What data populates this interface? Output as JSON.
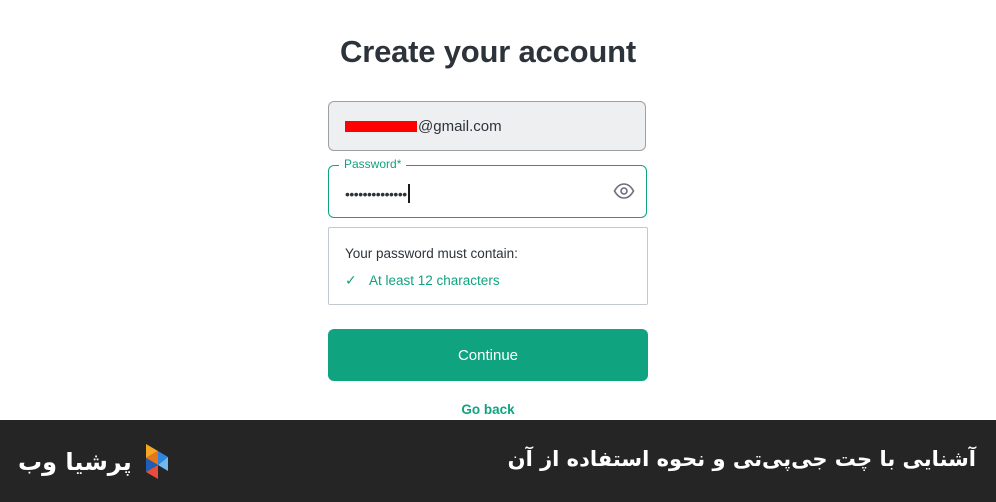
{
  "page": {
    "title": "Create your account"
  },
  "email": {
    "visible_suffix": "@gmail.com"
  },
  "password": {
    "label": "Password*",
    "masked_value": "••••••••••••••"
  },
  "requirements": {
    "heading": "Your password must contain:",
    "items": [
      {
        "check": "✓",
        "text": "At least 12 characters",
        "status": "met"
      }
    ]
  },
  "actions": {
    "continue_label": "Continue",
    "go_back_label": "Go back"
  },
  "banner": {
    "title": "آشنایی با چت جی‌پی‌تی و نحوه استفاده از آن",
    "brand_name": "پرشیا وب"
  },
  "icons": {
    "password_toggle": "eye-icon",
    "brand_logo": "persia-web-logo-icon"
  },
  "colors": {
    "accent": "#10a37f",
    "banner_bg": "#252525",
    "redaction": "#ff0000"
  }
}
